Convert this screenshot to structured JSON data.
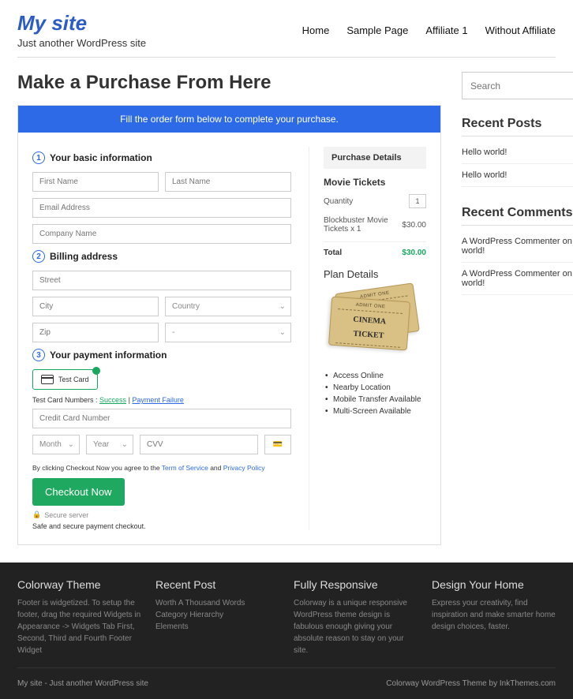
{
  "site": {
    "title": "My site",
    "tagline": "Just another WordPress site"
  },
  "nav": [
    {
      "label": "Home"
    },
    {
      "label": "Sample Page"
    },
    {
      "label": "Affiliate 1"
    },
    {
      "label": "Without Affiliate"
    }
  ],
  "page_title": "Make a Purchase From Here",
  "form": {
    "banner": "Fill the order form below to complete your purchase.",
    "s1": "Your basic information",
    "first_name": "First Name",
    "last_name": "Last Name",
    "email": "Email Address",
    "company": "Company Name",
    "s2": "Billing address",
    "street": "Street",
    "city": "City",
    "country": "Country",
    "zip": "Zip",
    "state": "-",
    "s3": "Your payment information",
    "test_card": "Test Card",
    "tcn_pre": "Test Card Numbers :",
    "tcn_success": "Success",
    "tcn_sep": " | ",
    "tcn_fail": "Payment Failure",
    "cc": "Credit Card Number",
    "month": "Month",
    "year": "Year",
    "cvv": "CVV",
    "agree_pre": "By clicking Checkout Now you agree to the ",
    "tos": "Term of Service",
    "and": " and ",
    "pp": "Privacy Policy",
    "checkout": "Checkout Now",
    "secure": "Secure server",
    "secure_note": "Safe and secure payment checkout."
  },
  "details": {
    "head": "Purchase Details",
    "sub": "Movie Tickets",
    "qty_label": "Quantity",
    "qty": "1",
    "item": "Blockbuster Movie Tickets x 1",
    "item_price": "$30.00",
    "total_label": "Total",
    "total": "$30.00",
    "plan": "Plan Details",
    "admit": "ADMIT ONE",
    "cinema1": "CINEMA",
    "cinema2": "TICKET",
    "features": [
      "Access Online",
      "Nearby Location",
      "Mobile Transfer Available",
      "Multi-Screen Available"
    ]
  },
  "sidebar": {
    "search": "Search",
    "posts_title": "Recent Posts",
    "posts": [
      "Hello world!",
      "Hello world!"
    ],
    "comments_title": "Recent Comments",
    "comments": [
      {
        "author": "A WordPress Commenter",
        "on": " on ",
        "post": "Hello world!"
      },
      {
        "author": "A WordPress Commenter",
        "on": " on ",
        "post": "Hello world!"
      }
    ]
  },
  "footer": {
    "cols": [
      {
        "title": "Colorway Theme",
        "body": "Footer is widgetized. To setup the footer, drag the required Widgets in Appearance -> Widgets Tab First, Second, Third and Fourth Footer Widget"
      },
      {
        "title": "Recent Post",
        "body": "Worth A Thousand Words\nCategory Hierarchy\nElements"
      },
      {
        "title": "Fully Responsive",
        "body": "Colorway is a unique responsive WordPress theme design is fabulous enough giving your absolute reason to stay on your site."
      },
      {
        "title": "Design Your Home",
        "body": "Express your creativity, find inspiration and make smarter home design choices, faster."
      }
    ],
    "left": "My site - Just another WordPress site",
    "right": "Colorway WordPress Theme by InkThemes.com"
  }
}
